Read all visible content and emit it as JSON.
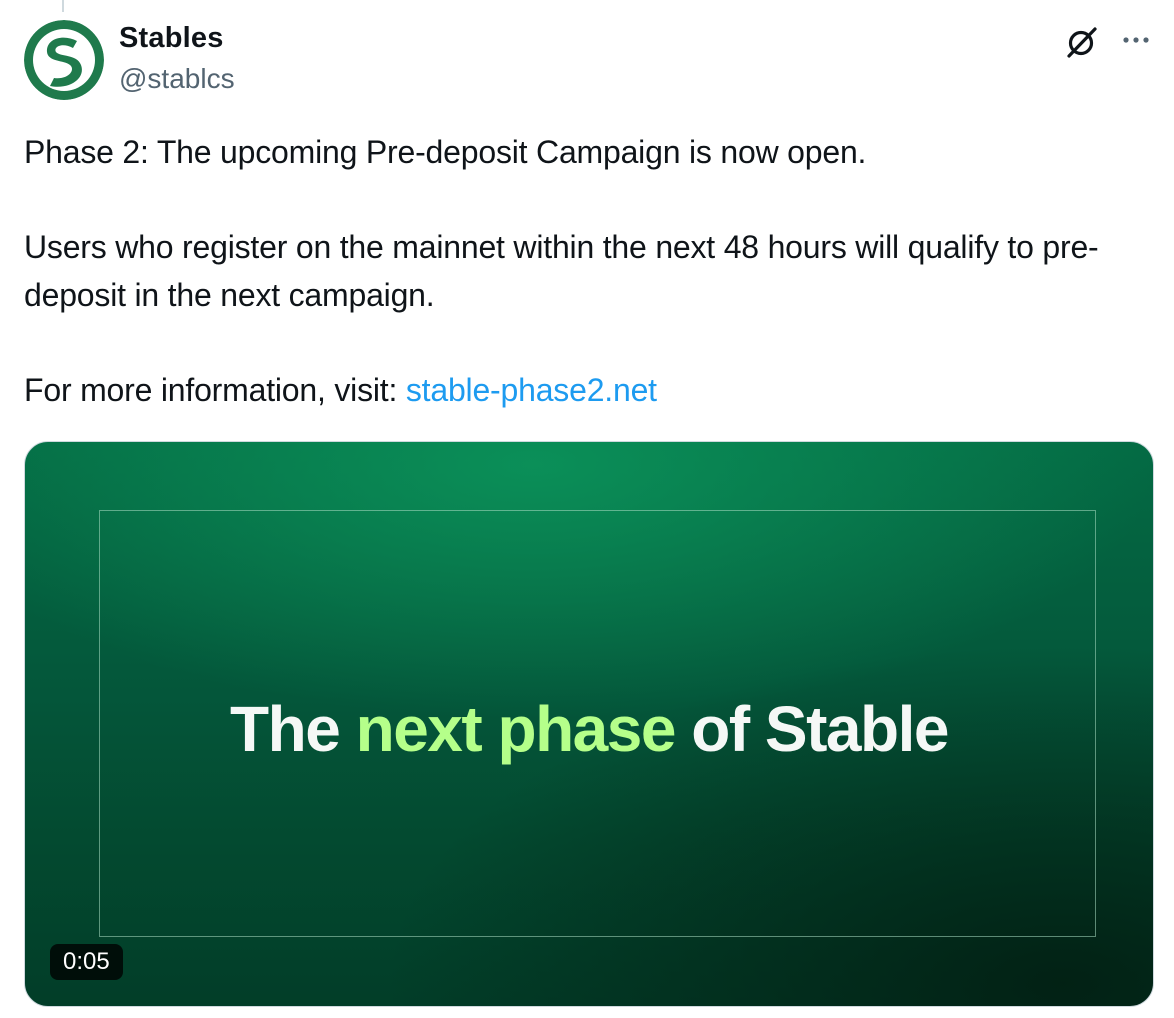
{
  "author": {
    "display_name": "Stables",
    "handle": "@stablcs",
    "avatar_letter": "S",
    "avatar_color": "#1f7a4c"
  },
  "header_icons": {
    "grok": "grok-icon",
    "more": "more-icon"
  },
  "tweet": {
    "line1": "Phase 2: The upcoming Pre-deposit Campaign is now open.",
    "line2": "Users who register on the mainnet within the next 48 hours will qualify to pre-deposit in the next campaign.",
    "line3_prefix": "For more information, visit: ",
    "link_text": "stable-phase2.net",
    "link_color": "#1d9bf0"
  },
  "media": {
    "headline_part1": "The ",
    "headline_accent": "next phase",
    "headline_part2": " of Stable",
    "accent_color": "#b5ff8a",
    "duration": "0:05"
  }
}
